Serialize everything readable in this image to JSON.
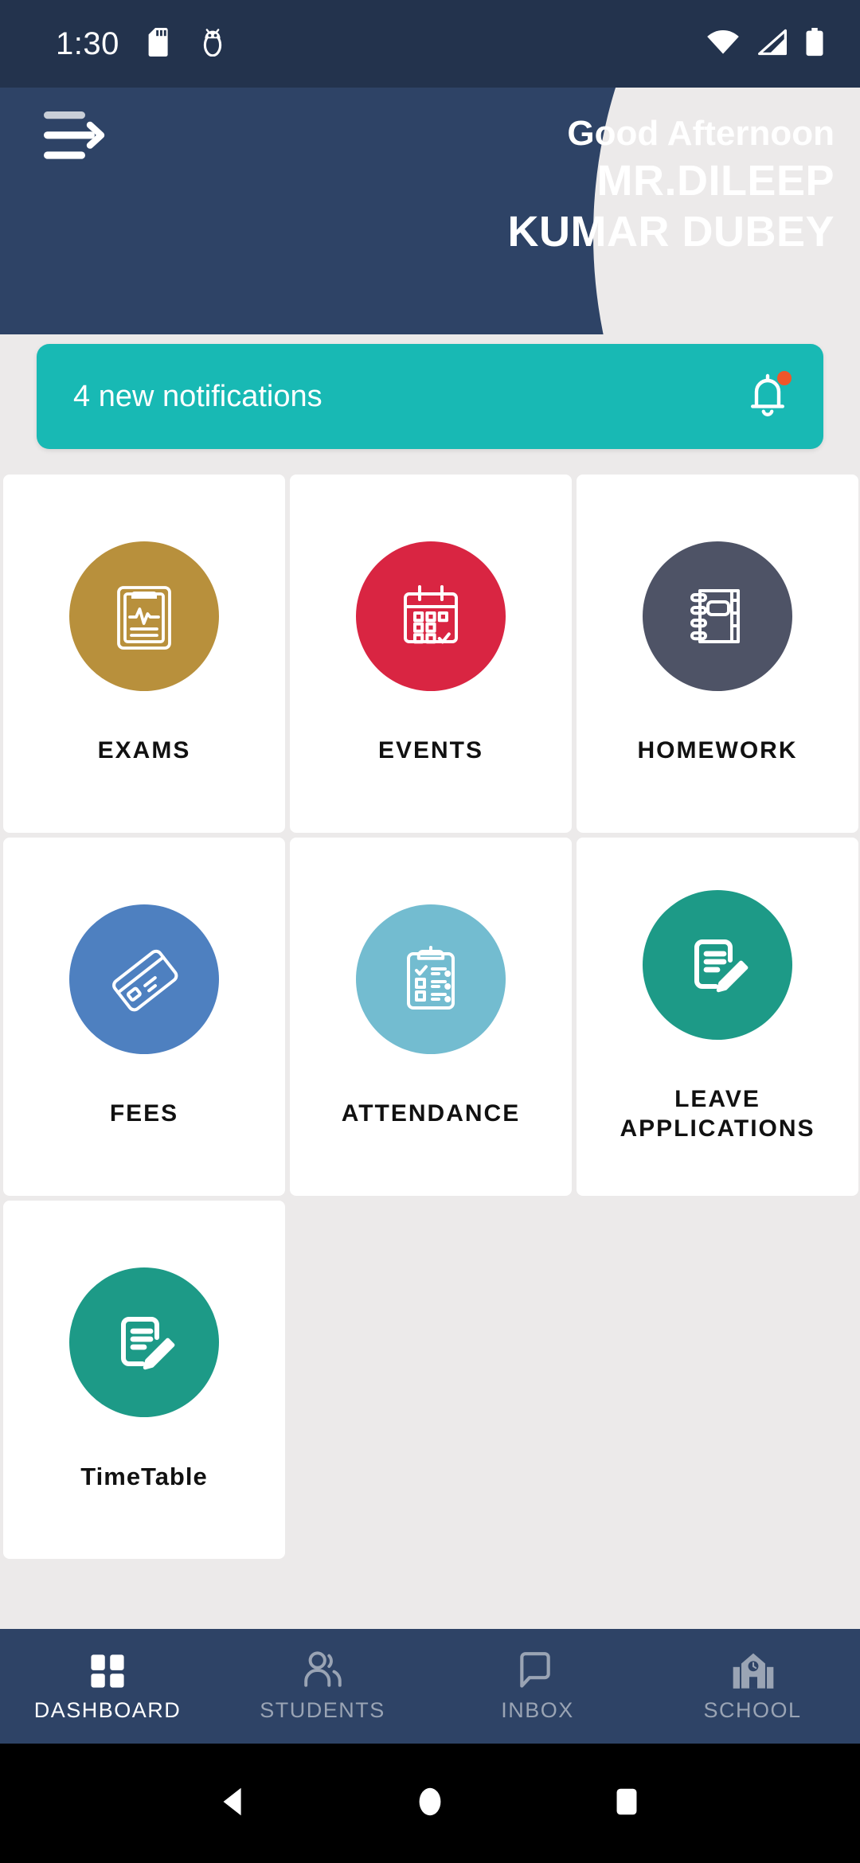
{
  "status_bar": {
    "time": "1:30",
    "icons": [
      "sd-card-icon",
      "android-debug-icon",
      "wifi-icon",
      "cellular-signal-icon",
      "battery-icon"
    ]
  },
  "header": {
    "menu_icon": "hamburger-arrow-icon",
    "greeting": "Good Afternoon",
    "user_name_line1": "MR.DILEEP",
    "user_name_line2": "KUMAR DUBEY",
    "background_color": "#2e4366"
  },
  "notification": {
    "text": "4 new notifications",
    "icon": "bell-icon",
    "badge_color": "#f0562a",
    "background_color": "#18b9b4"
  },
  "grid": {
    "items": [
      {
        "label": "EXAMS",
        "icon": "clipboard-pulse-icon",
        "color": "#b8903c",
        "style": "upper"
      },
      {
        "label": "EVENTS",
        "icon": "calendar-check-icon",
        "color": "#d92542",
        "style": "upper"
      },
      {
        "label": "HOMEWORK",
        "icon": "spiral-notebook-icon",
        "color": "#4e5366",
        "style": "upper"
      },
      {
        "label": "FEES",
        "icon": "credit-card-icon",
        "color": "#4e80c0",
        "style": "upper"
      },
      {
        "label": "ATTENDANCE",
        "icon": "clipboard-check-icon",
        "color": "#73bcd0",
        "style": "upper"
      },
      {
        "label": "LEAVE\nAPPLICATIONS",
        "icon": "document-pencil-icon",
        "color": "#1d9a87",
        "style": "upper"
      },
      {
        "label": "TimeTable",
        "icon": "document-pencil-icon",
        "color": "#1d9a87",
        "style": "mixed"
      }
    ]
  },
  "bottom_nav": {
    "items": [
      {
        "label": "DASHBOARD",
        "icon": "grid-squares-icon",
        "active": true
      },
      {
        "label": "STUDENTS",
        "icon": "people-icon",
        "active": false
      },
      {
        "label": "INBOX",
        "icon": "chat-bubble-icon",
        "active": false
      },
      {
        "label": "SCHOOL",
        "icon": "school-clock-icon",
        "active": false
      }
    ]
  },
  "android_nav": {
    "back": "back-triangle-icon",
    "home": "home-circle-icon",
    "recents": "recents-square-icon"
  }
}
